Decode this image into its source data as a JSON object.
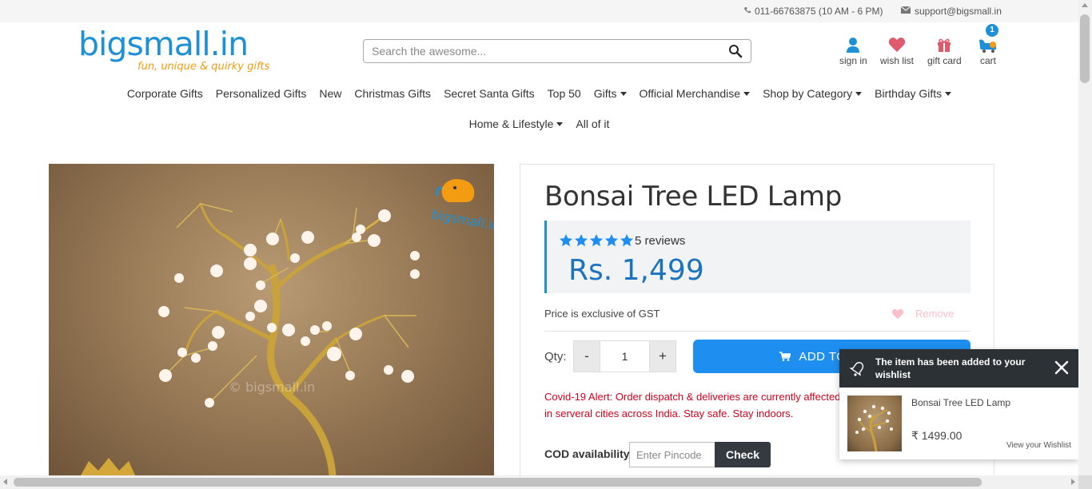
{
  "topbar": {
    "phone": "011-66763875 (10 AM - 6 PM)",
    "email": "support@bigsmall.in"
  },
  "logo": {
    "main": "bigsmall.in",
    "tagline": "fun, unique & quirky gifts"
  },
  "search": {
    "placeholder": "Search the awesome..."
  },
  "header_icons": {
    "sign_in": "sign in",
    "wish_list": "wish list",
    "gift_card": "gift card",
    "cart": "cart",
    "cart_count": "1"
  },
  "nav": {
    "row1": [
      {
        "label": "Corporate Gifts",
        "dropdown": false
      },
      {
        "label": "Personalized Gifts",
        "dropdown": false
      },
      {
        "label": "New",
        "dropdown": false
      },
      {
        "label": "Christmas Gifts",
        "dropdown": false
      },
      {
        "label": "Secret Santa Gifts",
        "dropdown": false
      },
      {
        "label": "Top 50",
        "dropdown": false
      },
      {
        "label": "Gifts",
        "dropdown": true
      },
      {
        "label": "Official Merchandise",
        "dropdown": true
      },
      {
        "label": "Shop by Category",
        "dropdown": true
      },
      {
        "label": "Birthday Gifts",
        "dropdown": true
      }
    ],
    "row2": [
      {
        "label": "Home & Lifestyle",
        "dropdown": true
      },
      {
        "label": "All of it",
        "dropdown": false
      }
    ]
  },
  "product": {
    "image_watermark": "© bigsmall.in",
    "image_badge": "bigsmall.in",
    "title": "Bonsai Tree LED Lamp",
    "rating": 5,
    "reviews": "5 reviews",
    "price": "Rs. 1,499",
    "gst_note": "Price is exclusive of GST",
    "remove_label": "Remove",
    "qty_label": "Qty:",
    "qty_minus": "-",
    "qty_value": "1",
    "qty_plus": "+",
    "add_to_cart": "ADD TO CART",
    "covid_alert": "Covid-19 Alert: Order dispatch & deliveries are currently affected in serveral cities across India. Stay safe. Stay indoors.",
    "cod_label": "COD availability",
    "pincode_placeholder": "Enter Pincode",
    "check_label": "Check"
  },
  "toast": {
    "message": "The item has been added to your wishlist",
    "item_name": "Bonsai Tree LED Lamp",
    "item_price": "₹ 1499.00",
    "link": "View your Wishlist"
  },
  "colors": {
    "brand_blue": "#1e90d6",
    "brand_orange": "#f39c12",
    "cart_button": "#1e8ff0",
    "alert_red": "#d0021b",
    "toast_header": "#2c3136"
  }
}
